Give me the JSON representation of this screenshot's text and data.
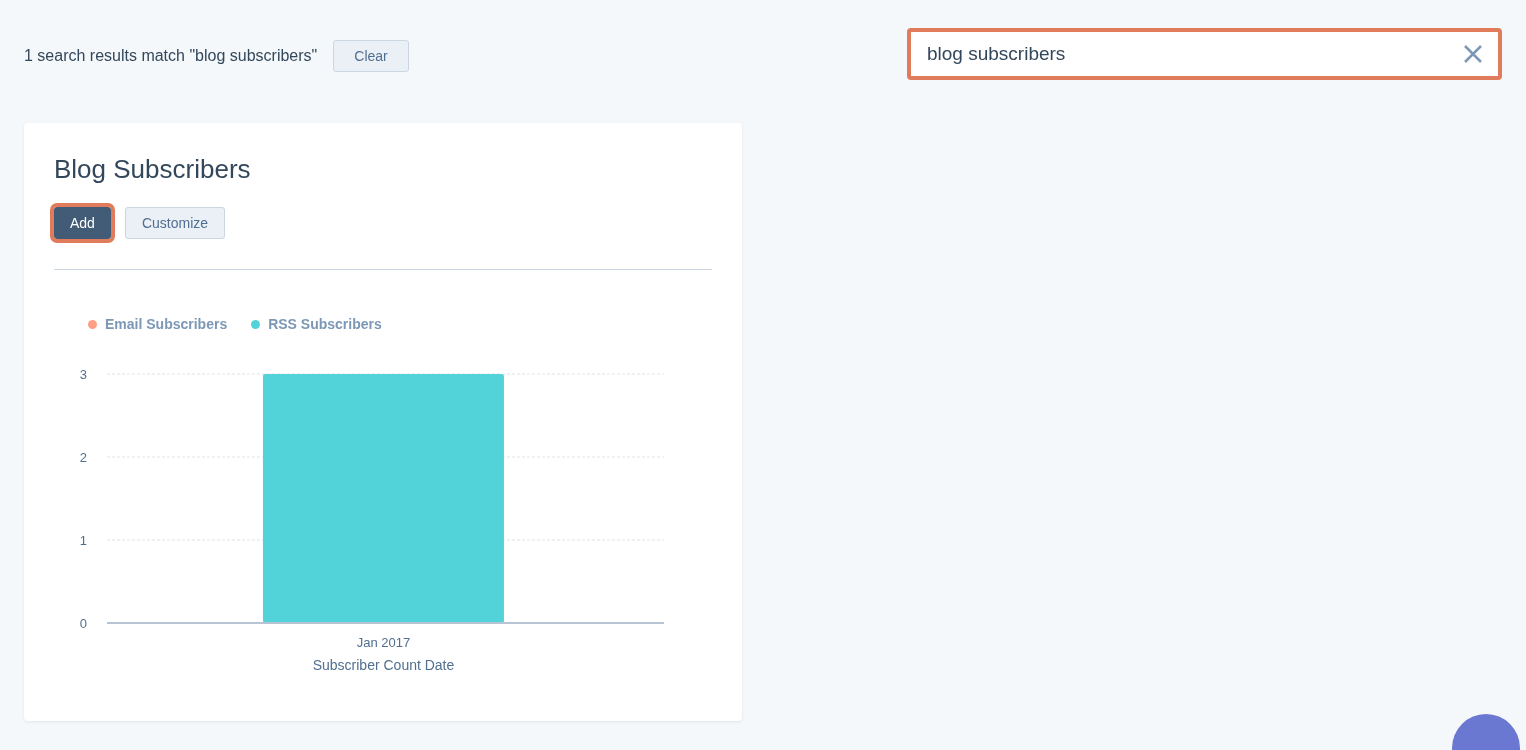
{
  "search_summary": {
    "text": "1 search results match \"blog subscribers\"",
    "clear_button": "Clear"
  },
  "search": {
    "value": "blog subscribers",
    "highlighted": true
  },
  "card": {
    "title": "Blog Subscribers",
    "buttons": [
      {
        "label": "Add",
        "kind": "primary",
        "highlighted": true
      },
      {
        "label": "Customize",
        "kind": "secondary",
        "highlighted": false
      }
    ],
    "chart_data": {
      "type": "bar",
      "xlabel": "Subscriber Count Date",
      "categories": [
        "Jan 2017"
      ],
      "series": [
        {
          "name": "Email Subscribers",
          "color": "#ff9f87",
          "values": [
            null
          ]
        },
        {
          "name": "RSS Subscribers",
          "color": "#51d3d9",
          "values": [
            3
          ]
        }
      ],
      "ylim": [
        0,
        3
      ],
      "yticks": [
        0,
        1,
        2,
        3
      ]
    }
  }
}
